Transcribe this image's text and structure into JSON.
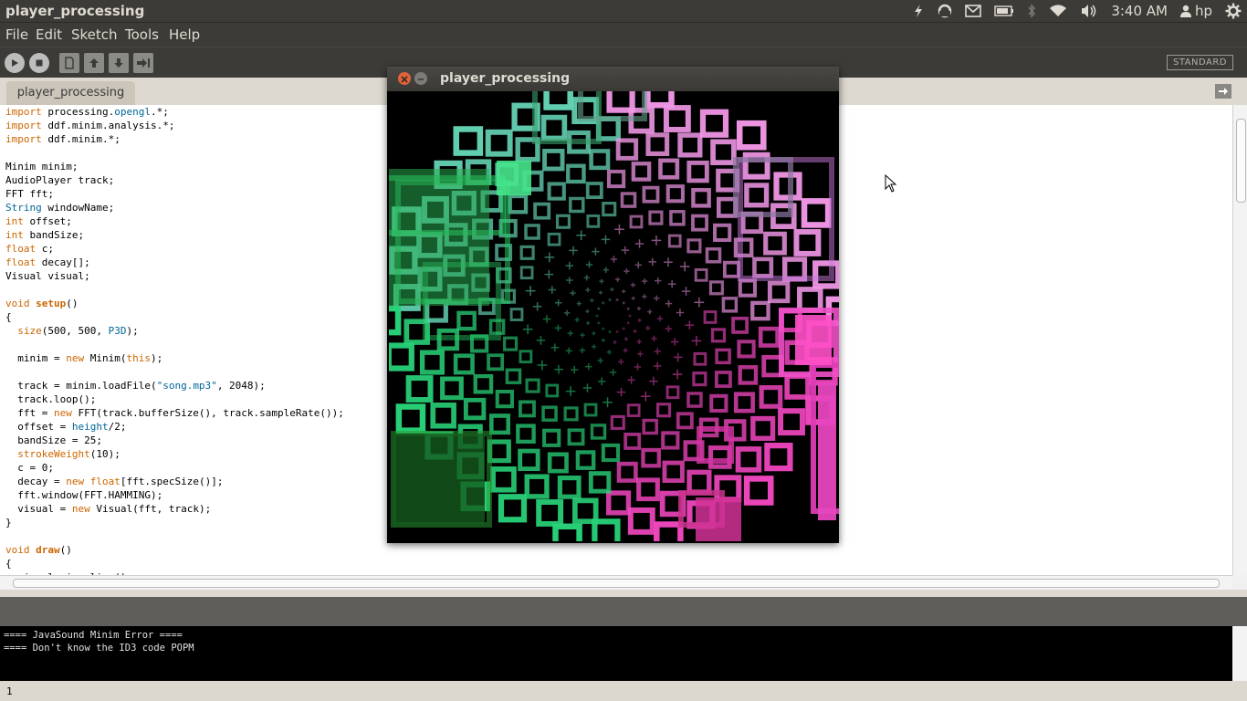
{
  "topbar": {
    "app_title": "player_processing",
    "tray": {
      "icons": [
        "indicator-icon",
        "ubuntu-one-icon",
        "mail-icon",
        "battery-icon",
        "bluetooth-icon",
        "wifi-icon",
        "volume-icon"
      ],
      "clock": "3:40 AM",
      "user": "hp"
    }
  },
  "menubar": {
    "items": [
      "File",
      "Edit",
      "Sketch",
      "Tools",
      "Help"
    ]
  },
  "toolbar": {
    "buttons": [
      "run-button",
      "stop-button",
      "new-button",
      "open-button",
      "save-button",
      "export-button"
    ],
    "mode": "STANDARD"
  },
  "tabs": {
    "active": "player_processing"
  },
  "editor": {
    "lines": [
      "import processing.opengl.*;",
      "import ddf.minim.analysis.*;",
      "import ddf.minim.*;",
      "",
      "Minim minim;",
      "AudioPlayer track;",
      "FFT fft;",
      "String windowName;",
      "int offset;",
      "int bandSize;",
      "float c;",
      "float decay[];",
      "Visual visual;",
      "",
      "void setup()",
      "{",
      "  size(500, 500, P3D);",
      "",
      "  minim = new Minim(this);",
      "",
      "  track = minim.loadFile(\"song.mp3\", 2048);",
      "  track.loop();",
      "  fft = new FFT(track.bufferSize(), track.sampleRate());",
      "  offset = height/2;",
      "  bandSize = 25;",
      "  strokeWeight(10);",
      "  c = 0;",
      "  decay = new float[fft.specSize()];",
      "  fft.window(FFT.HAMMING);",
      "  visual = new Visual(fft, track);",
      "}",
      "",
      "void draw()",
      "{",
      "  visual.visualize();"
    ]
  },
  "console": {
    "lines": [
      "==== JavaSound Minim Error ====",
      "==== Don't know the ID3 code POPM"
    ]
  },
  "status": {
    "line_number": "1"
  },
  "sketch_window": {
    "title": "player_processing"
  },
  "colors": {
    "panel": "#3c3b37",
    "panel_text": "#dfdbd2",
    "keyword": "#cc6600",
    "type": "#006699",
    "green_particles": "#3ddc84",
    "pink_particles": "#ff4fb0"
  }
}
